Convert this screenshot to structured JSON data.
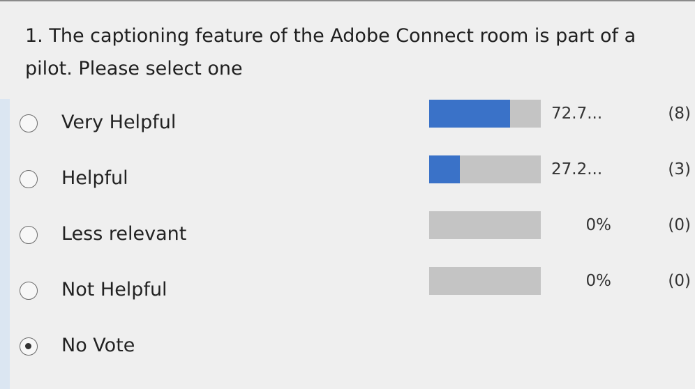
{
  "poll": {
    "question": "1. The captioning feature of the Adobe Connect room is part of a pilot. Please select one",
    "options": [
      {
        "label": "Very Helpful",
        "percent_text": "72.7...",
        "count": "(8)",
        "fill_fraction": 0.727,
        "selected": false
      },
      {
        "label": "Helpful",
        "percent_text": "27.2...",
        "count": "(3)",
        "fill_fraction": 0.272,
        "selected": false
      },
      {
        "label": "Less relevant",
        "percent_text": "0%",
        "count": "(0)",
        "fill_fraction": 0,
        "selected": false
      },
      {
        "label": "Not Helpful",
        "percent_text": "0%",
        "count": "(0)",
        "fill_fraction": 0,
        "selected": false
      },
      {
        "label": "No Vote",
        "selected": true
      }
    ]
  },
  "colors": {
    "bar_fill": "#3a72c8",
    "bar_track": "#c4c4c4"
  }
}
